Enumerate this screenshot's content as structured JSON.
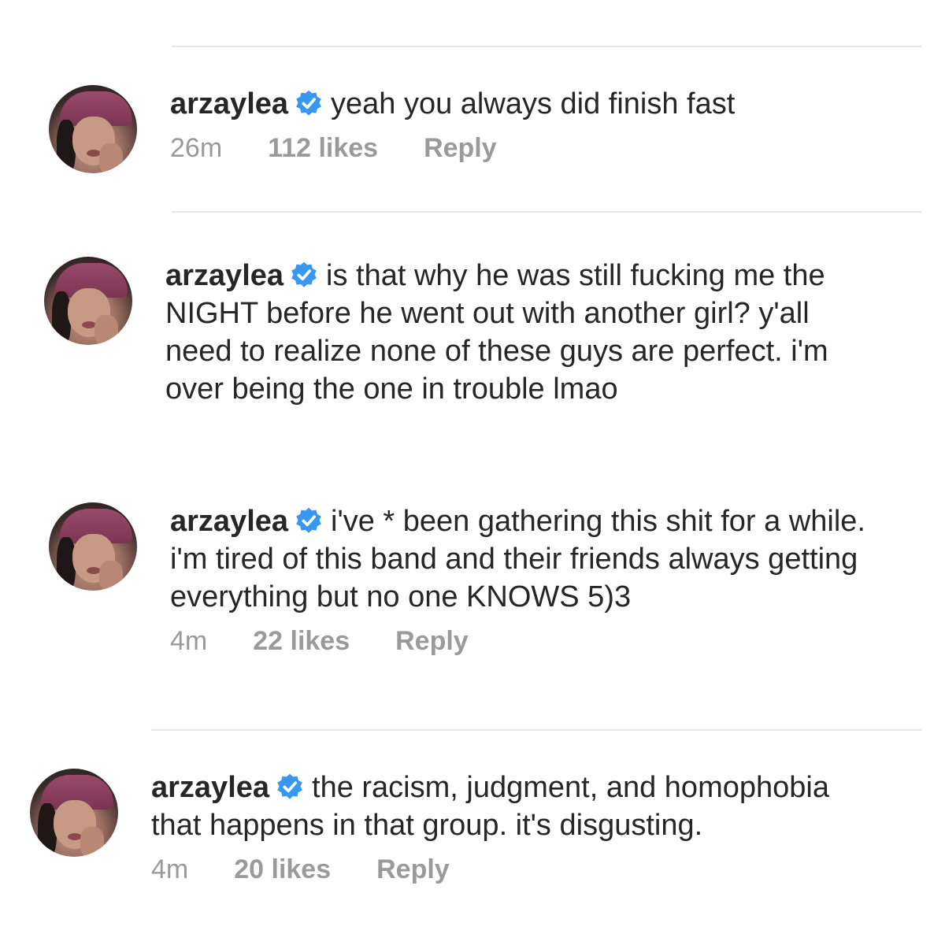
{
  "comments": [
    {
      "username": "arzaylea",
      "text": "yeah you always did finish fast",
      "time": "26m",
      "likes": "112 likes",
      "reply": "Reply"
    },
    {
      "username": "arzaylea",
      "text": "is that why he was still fucking me the NIGHT before he went out with another girl? y'all need to realize none of these guys are perfect. i'm over being the one in trouble lmao"
    },
    {
      "username": "arzaylea",
      "text": "i've * been gathering this shit for a while. i'm tired of this band and their friends always getting everything but no one KNOWS 5)3",
      "time": "4m",
      "likes": "22 likes",
      "reply": "Reply"
    },
    {
      "username": "arzaylea",
      "text": "the racism, judgment, and homophobia that happens in that group. it's disgusting.",
      "time": "4m",
      "likes": "20 likes",
      "reply": "Reply"
    }
  ],
  "colors": {
    "verified_badge": "#3897f0",
    "meta_text": "#9a9a9a",
    "divider": "#e6e6e6"
  },
  "icons": {
    "verified": "verified-badge-icon"
  }
}
